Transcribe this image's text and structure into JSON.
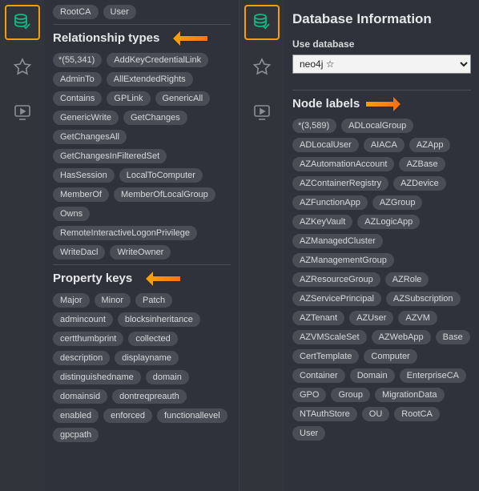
{
  "left": {
    "top_tags": [
      "RootCA",
      "User"
    ],
    "rel_heading": "Relationship types",
    "rel_tags_first": "*(55,341)",
    "rel_tags": [
      "AddKeyCredentialLink",
      "AdminTo",
      "AllExtendedRights",
      "Contains",
      "GPLink",
      "GenericAll",
      "GenericWrite",
      "GetChanges",
      "GetChangesAll",
      "GetChangesInFilteredSet",
      "HasSession",
      "LocalToComputer",
      "MemberOf",
      "MemberOfLocalGroup",
      "Owns",
      "RemoteInteractiveLogonPrivilege",
      "WriteDacl",
      "WriteOwner"
    ],
    "prop_heading": "Property keys",
    "prop_tags": [
      "Major",
      "Minor",
      "Patch",
      "admincount",
      "blocksinheritance",
      "certthumbprint",
      "collected",
      "description",
      "displayname",
      "distinguishedname",
      "domain",
      "domainsid",
      "dontreqpreauth",
      "enabled",
      "enforced",
      "functionallevel",
      "gpcpath"
    ]
  },
  "right": {
    "title": "Database Information",
    "use_db_label": "Use database",
    "use_db_value": "neo4j ☆",
    "node_heading": "Node labels",
    "node_first": "*(3,589)",
    "node_tags": [
      "ADLocalGroup",
      "ADLocalUser",
      "AIACA",
      "AZApp",
      "AZAutomationAccount",
      "AZBase",
      "AZContainerRegistry",
      "AZDevice",
      "AZFunctionApp",
      "AZGroup",
      "AZKeyVault",
      "AZLogicApp",
      "AZManagedCluster",
      "AZManagementGroup",
      "AZResourceGroup",
      "AZRole",
      "AZServicePrincipal",
      "AZSubscription",
      "AZTenant",
      "AZUser",
      "AZVM",
      "AZVMScaleSet",
      "AZWebApp",
      "Base",
      "CertTemplate",
      "Computer",
      "Container",
      "Domain",
      "EnterpriseCA",
      "GPO",
      "Group",
      "MigrationData",
      "NTAuthStore",
      "OU",
      "RootCA",
      "User"
    ]
  }
}
